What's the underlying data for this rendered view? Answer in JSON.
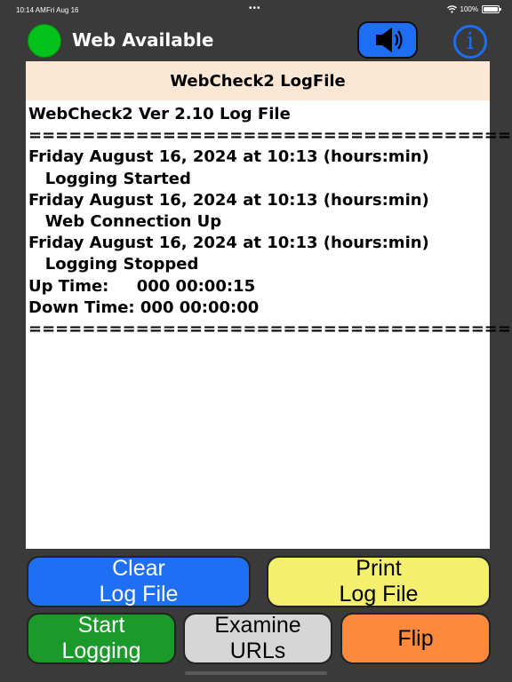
{
  "status_bar": {
    "time": "10:14 AM",
    "date": "Fri Aug 16",
    "dots": "•••",
    "battery": "100%"
  },
  "header": {
    "web_status_label": "Web Available",
    "web_status_color": "#00c21a",
    "sound_icon": "speaker-icon",
    "info_icon_glyph": "i"
  },
  "log": {
    "title": "WebCheck2 LogFile",
    "lines": [
      "WebCheck2 Ver 2.10 Log File",
      "=====================================",
      "Friday August 16, 2024 at 10:13 (hours:min)",
      "   Logging Started",
      "Friday August 16, 2024 at 10:13 (hours:min)",
      "   Web Connection Up",
      "Friday August 16, 2024 at 10:13 (hours:min)",
      "   Logging Stopped",
      "Up Time:     000 00:00:15",
      "Down Time: 000 00:00:00",
      "====================================="
    ]
  },
  "buttons": {
    "clear": "Clear\nLog File",
    "print": "Print\nLog File",
    "start": "Start\nLogging",
    "examine": "Examine\nURLs",
    "flip": "Flip"
  },
  "colors": {
    "blue": "#1f6ff5",
    "yellow": "#f4f06e",
    "green": "#1b9a2c",
    "gray": "#d6d6d6",
    "orange": "#fb8a3c",
    "log_header_bg": "#fbe7d3"
  }
}
